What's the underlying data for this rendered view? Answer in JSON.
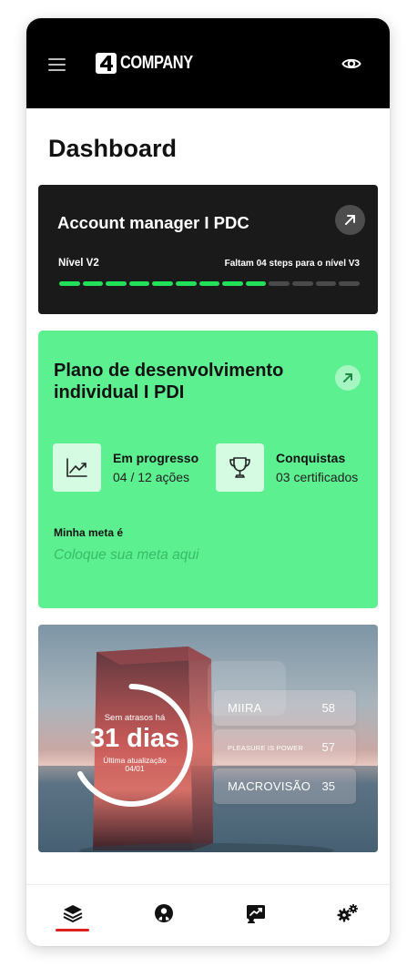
{
  "header": {
    "logo_text": "COMPANY",
    "logo_mark": "4"
  },
  "page_title": "Dashboard",
  "career_card": {
    "title": "Account manager I PDC",
    "level": "Nível V2",
    "remaining": "Faltam 04 steps para o nível V3",
    "progress": {
      "completed_steps": 9,
      "total_steps": 13
    },
    "colors": {
      "done": "#22e05a",
      "pending": "#4a4a4a"
    }
  },
  "pdi_card": {
    "title": "Plano de desenvolvimento individual I PDI",
    "stats": [
      {
        "label": "Em progresso",
        "value": "04 / 12 ações",
        "icon": "trending-up-icon"
      },
      {
        "label": "Conquistas",
        "value": "03 certificados",
        "icon": "trophy-icon"
      }
    ],
    "goal_label": "Minha meta é",
    "goal_placeholder": "Coloque sua meta aqui",
    "color": "#5cf090"
  },
  "streak_card": {
    "caption": "Sem atrasos há",
    "value": "31 dias",
    "update_label": "Última atualização",
    "update_date": "04/01",
    "ranking": [
      {
        "name": "MIIRA",
        "value": "58"
      },
      {
        "name": "PLEASURE IS POWER",
        "value": "57"
      },
      {
        "name": "MACROVISÃO",
        "value": "35"
      }
    ]
  },
  "nav": {
    "items": [
      "layers-icon",
      "profile-icon",
      "growth-icon",
      "settings-icon"
    ],
    "active_color": "#e02020"
  }
}
